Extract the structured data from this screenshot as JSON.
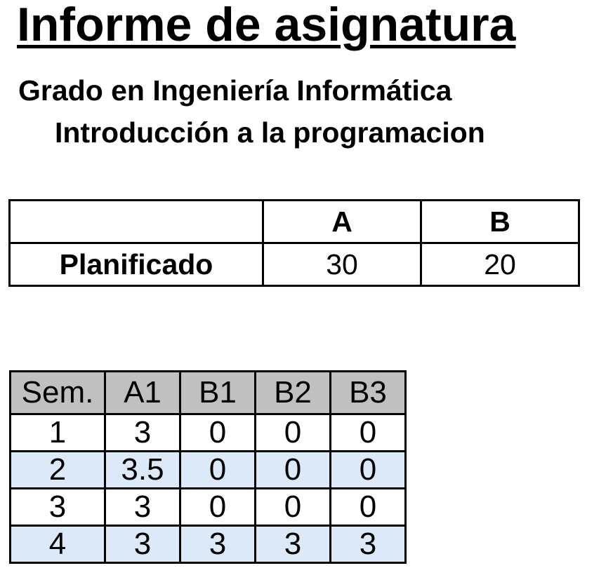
{
  "header": {
    "title": "Informe de asignatura",
    "degree": "Grado en Ingeniería Informática",
    "course": "Introducción a la programacion"
  },
  "plan_table": {
    "columns": [
      "",
      "A",
      "B"
    ],
    "row_label": "Planificado",
    "values": [
      "30",
      "20"
    ]
  },
  "weekly_table": {
    "columns": [
      "Sem.",
      "A1",
      "B1",
      "B2",
      "B3"
    ],
    "rows": [
      [
        "1",
        "3",
        "0",
        "0",
        "0"
      ],
      [
        "2",
        "3.5",
        "0",
        "0",
        "0"
      ],
      [
        "3",
        "3",
        "0",
        "0",
        "0"
      ],
      [
        "4",
        "3",
        "3",
        "3",
        "3"
      ]
    ],
    "colors": {
      "header_bg": "#c0c0c0",
      "stripe_bg": "#dce9f8",
      "row_bg": "#ffffff"
    }
  }
}
